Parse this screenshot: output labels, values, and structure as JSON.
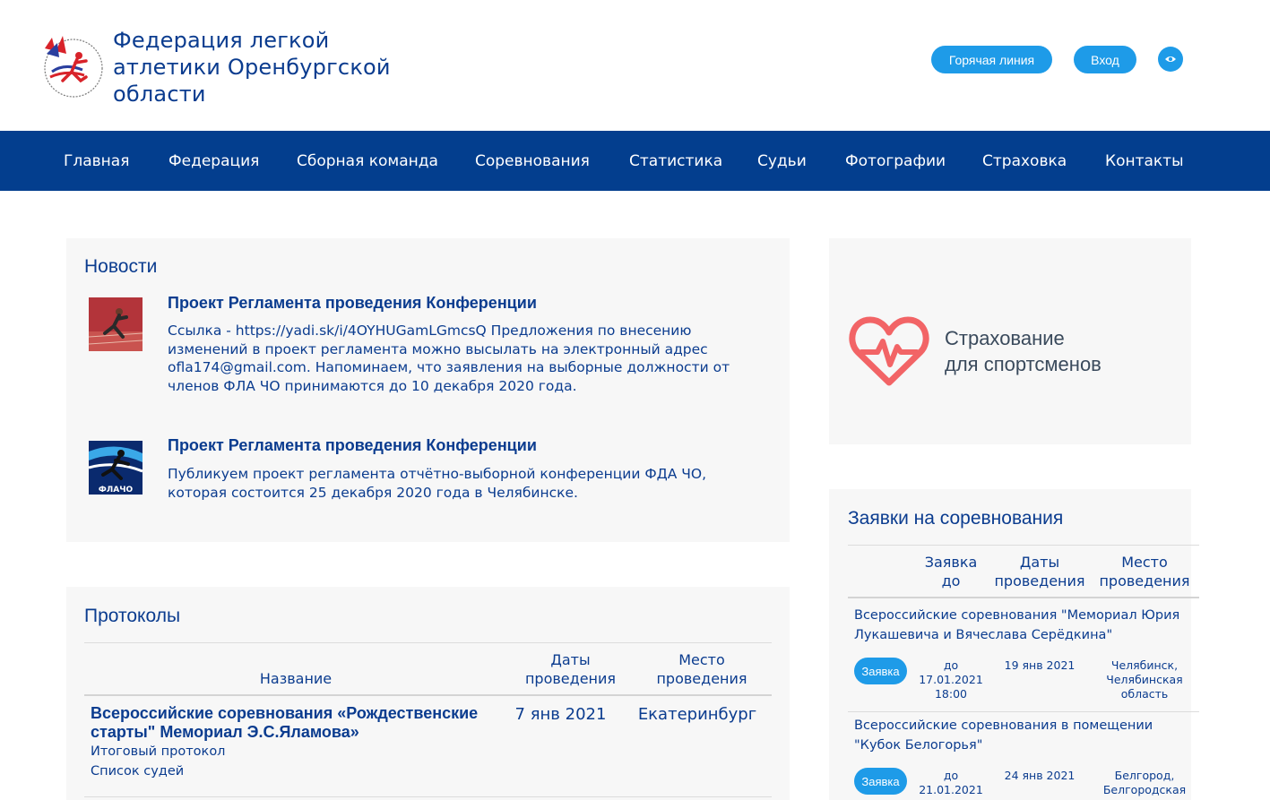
{
  "header": {
    "title": "Федерация легкой атлетики Оренбургской области",
    "hotline_label": "Горячая линия",
    "login_label": "Вход",
    "accessibility_icon": "eye-icon",
    "logo_icon": "federation-logo-icon"
  },
  "nav": {
    "items": [
      {
        "label": "Главная"
      },
      {
        "label": "Федерация"
      },
      {
        "label": "Сборная команда"
      },
      {
        "label": "Соревнования"
      },
      {
        "label": "Статистика"
      },
      {
        "label": "Судьи"
      },
      {
        "label": "Фотографии"
      },
      {
        "label": "Страховка"
      },
      {
        "label": "Контакты"
      }
    ]
  },
  "news": {
    "title": "Новости",
    "items": [
      {
        "title": "Проект Регламента проведения Конференции",
        "text": "Ссылка - https://yadi.sk/i/4OYHUGamLGmcsQ Предложения по внесению изменений в проект регламента можно высылать на электронный адрес ofla174@gmail.com. Напоминаем, что заявления на выборные должности от членов ФЛА ЧО принимаются до 10 декабря 2020 года.",
        "thumb": "runner-photo"
      },
      {
        "title": "Проект Регламента проведения Конференции",
        "text": "Публикуем проект регламента отчётно-выборной конференции ФДА ЧО, которая состоится 25 декабря 2020 года в Челябинске.",
        "thumb": "flacho-logo"
      }
    ]
  },
  "protocols": {
    "title": "Протоколы",
    "headers": {
      "name": "Название",
      "dates": "Даты проведения",
      "place": "Место проведения"
    },
    "rows": [
      {
        "name": "Всероссийские соревнования «Рождественские старты\" Мемориал Э.С.Яламова»",
        "links": [
          "Итоговый протокол",
          "Список судей"
        ],
        "date": "7 янв 2021",
        "place": "Екатеринбург"
      }
    ]
  },
  "banner": {
    "title_line1": "Страхование",
    "title_line2": "для спортсменов",
    "icon": "heart-pulse-icon",
    "colors": {
      "heart": "#f26466",
      "text": "#3a4a5c"
    }
  },
  "applications": {
    "title": "Заявки на соревнования",
    "headers": {
      "deadline": "Заявка до",
      "dates": "Даты проведения",
      "place": "Место проведения"
    },
    "rows": [
      {
        "name": "Всероссийские соревнования \"Мемориал Юрия Лукашевича и Вячеслава Серёдкина\"",
        "button": "Заявка",
        "deadline": "до 17.01.2021 18:00",
        "date": "19 янв 2021",
        "place": "Челябинск, Челябинская область"
      },
      {
        "name": "Всероссийские соревнования в помещении \"Кубок Белогорья\"",
        "button": "Заявка",
        "deadline": "до 21.01.2021",
        "date": "24 янв 2021",
        "place": "Белгород, Белгородская"
      }
    ]
  },
  "colors": {
    "accent": "#1e9be8",
    "navbar": "#033e8e",
    "text": "#0b3c8f",
    "panel": "#f7f7f7"
  }
}
